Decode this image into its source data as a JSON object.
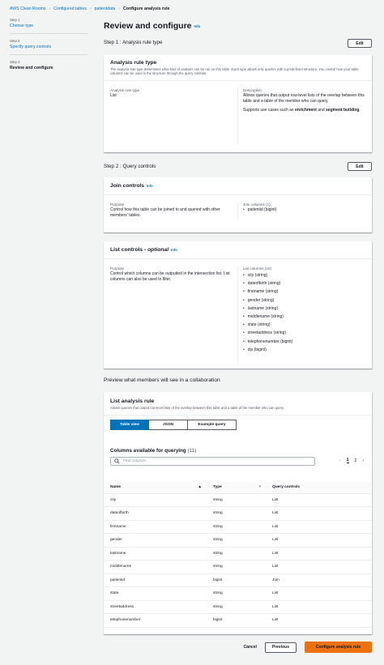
{
  "breadcrumb": [
    "AWS Clean Rooms",
    "Configured tables",
    "patientdata",
    "Configure analysis rule"
  ],
  "steps": [
    {
      "num": "Step 1",
      "label": "Choose type"
    },
    {
      "num": "Step 2",
      "label": "Specify query controls"
    },
    {
      "num": "Step 3",
      "label": "Review and configure"
    }
  ],
  "page_title": "Review and configure",
  "info": "Info",
  "step1": {
    "heading": "Step 1 : Analysis rule type",
    "edit": "Edit",
    "card_title": "Analysis rule type",
    "card_desc": "The analysis rule type determines what kind of analysis can be run on this table. Each type allows only queries with a predefined structure. You control how your table columns can be used in the structure through the query controls.",
    "left_key": "Analysis rule type",
    "left_val": "List",
    "right_key": "Description",
    "right_val": "Allows queries that output row-level lists of the overlap between this table and a table of the member who can query.",
    "right_val2_prefix": "Supports use cases such as ",
    "right_val2_b1": "enrichment",
    "right_val2_mid": " and ",
    "right_val2_b2": "segment building",
    "right_val2_end": "."
  },
  "step2": {
    "heading": "Step 2 : Query controls",
    "edit": "Edit",
    "join_title": "Join controls",
    "join_purpose_key": "Purpose",
    "join_purpose_val": "Control how this table can be joined to and queried with other members' tables.",
    "join_cols_key": "Join columns (1)",
    "join_cols": [
      "patientid (bigint)"
    ],
    "list_title": "List controls - ",
    "list_title_opt": "optional",
    "list_purpose_key": "Purpose",
    "list_purpose_val": "Control which columns can be outputted in the intersection list. List columns can also be used to filter.",
    "list_cols_key": "List columns (10)",
    "list_cols": [
      "city (string)",
      "dateofbirth (string)",
      "firstname (string)",
      "gender (string)",
      "lastname (string)",
      "middlename (string)",
      "state (string)",
      "streetaddress (string)",
      "telephonenumber (bigint)",
      "zip (bigint)"
    ]
  },
  "preview": {
    "heading": "Preview what members will see in a collaboration",
    "card_title": "List analysis rule",
    "card_desc": "Allows queries that output row-level lists of the overlap between this table and a table of the member who can query.",
    "tabs": [
      "Table view",
      "JSON",
      "Example query"
    ],
    "columns_title": "Columns available for querying",
    "columns_count": "(11)",
    "search_placeholder": "Find columns",
    "pages": [
      "1",
      "2"
    ],
    "headers": [
      "Name",
      "Type",
      "Query controls"
    ],
    "rows": [
      [
        "city",
        "string",
        "List"
      ],
      [
        "dateofbirth",
        "string",
        "List"
      ],
      [
        "firstname",
        "string",
        "List"
      ],
      [
        "gender",
        "string",
        "List"
      ],
      [
        "lastname",
        "string",
        "List"
      ],
      [
        "middlename",
        "string",
        "List"
      ],
      [
        "patientid",
        "bigint",
        "Join"
      ],
      [
        "state",
        "string",
        "List"
      ],
      [
        "streetaddress",
        "string",
        "List"
      ],
      [
        "telephonenumber",
        "bigint",
        "List"
      ]
    ]
  },
  "footer": {
    "cancel": "Cancel",
    "previous": "Previous",
    "submit": "Configure analysis rule"
  },
  "colors": {
    "accent": "#0073bb",
    "primary": "#ec7211",
    "bg": "#f2f3f3"
  }
}
